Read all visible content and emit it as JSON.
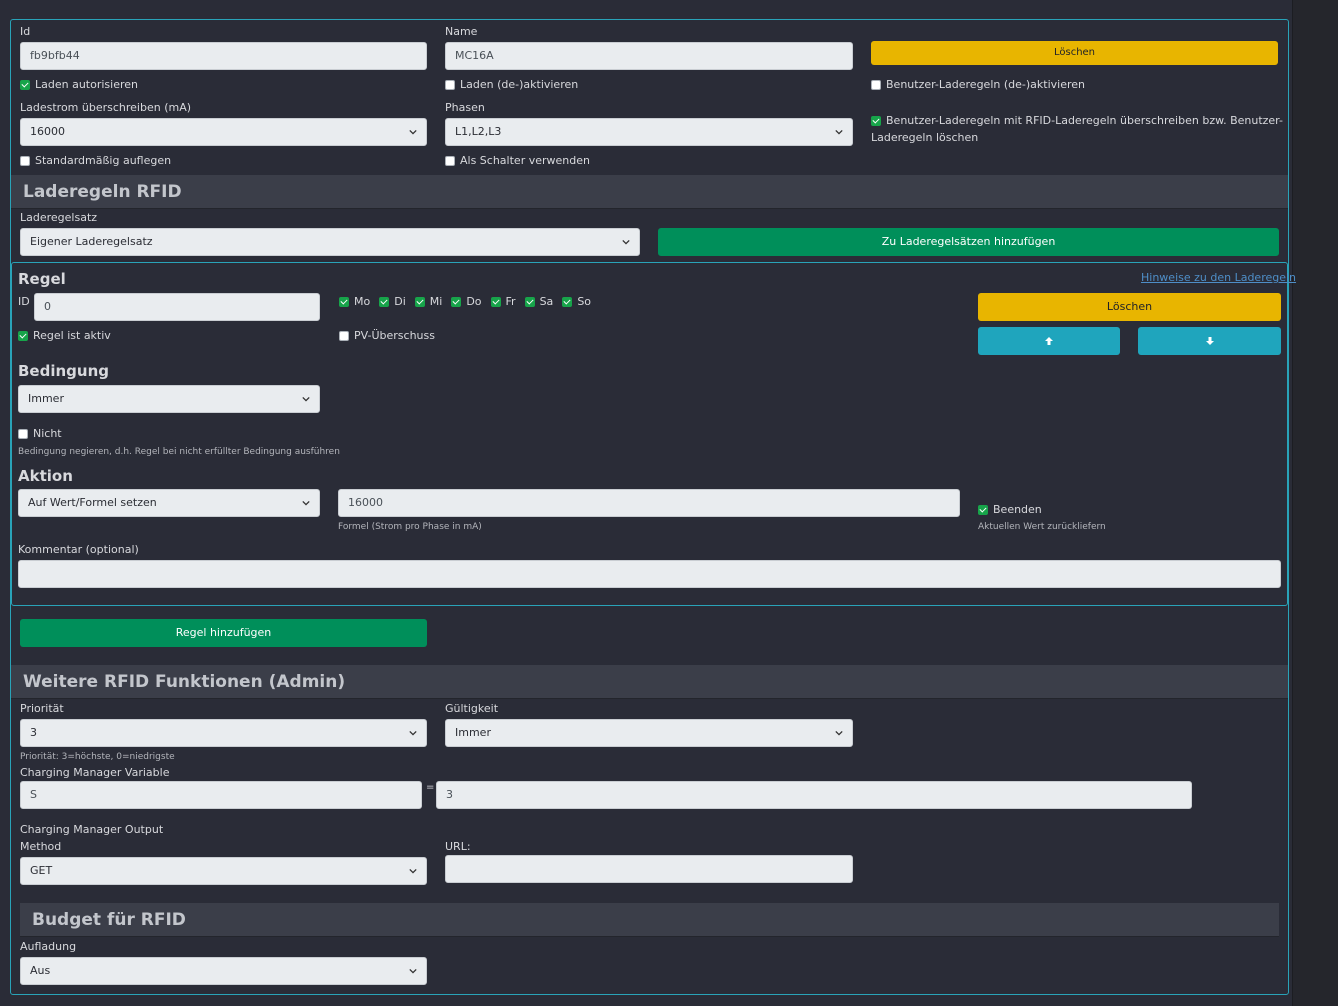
{
  "top": {
    "id_label": "Id",
    "id_value": "fb9bfb44",
    "name_label": "Name",
    "name_value": "MC16A",
    "delete_label": "Löschen",
    "laden_autorisieren": "Laden autorisieren",
    "laden_deaktivieren": "Laden (de-)aktivieren",
    "benutzer_deaktivieren": "Benutzer-Laderegeln (de-)aktivieren",
    "ladestrom_label": "Ladestrom überschreiben (mA)",
    "ladestrom_value": "16000",
    "phasen_label": "Phasen",
    "phasen_value": "L1,L2,L3",
    "benutzer_ueberschreiben_line1": "Benutzer-Laderegeln mit RFID-Laderegeln überschreiben bzw. Benutzer-",
    "benutzer_ueberschreiben_line2": "Laderegeln löschen",
    "standard_auflegen": "Standardmäßig auflegen",
    "als_schalter": "Als Schalter verwenden"
  },
  "laderegeln": {
    "section_title": "Laderegeln RFID",
    "satz_label": "Laderegelsatz",
    "satz_value": "Eigener Laderegelsatz",
    "add_to_sets_label": "Zu Laderegelsätzen hinzufügen"
  },
  "regel": {
    "title": "Regel",
    "hint_link": "Hinweise zu den Laderegeln",
    "id_label": "ID",
    "id_value": "0",
    "days": [
      "Mo",
      "Di",
      "Mi",
      "Do",
      "Fr",
      "Sa",
      "So"
    ],
    "delete_label": "Löschen",
    "aktiv_label": "Regel ist aktiv",
    "pv_label": "PV-Überschuss",
    "bedingung_title": "Bedingung",
    "bedingung_value": "Immer",
    "nicht_label": "Nicht",
    "nicht_help": "Bedingung negieren, d.h. Regel bei nicht erfüllter Bedingung ausführen",
    "aktion_title": "Aktion",
    "aktion_value": "Auf Wert/Formel setzen",
    "formel_value": "16000",
    "formel_help": "Formel (Strom pro Phase in mA)",
    "beenden_label": "Beenden",
    "beenden_help": "Aktuellen Wert zurückliefern",
    "kommentar_label": "Kommentar (optional)",
    "kommentar_value": ""
  },
  "add_rule_label": "Regel hinzufügen",
  "weitere": {
    "section_title": "Weitere RFID Funktionen (Admin)",
    "prioritaet_label": "Priorität",
    "prioritaet_value": "3",
    "prioritaet_help": "Priorität: 3=höchste, 0=niedrigste",
    "gueltigkeit_label": "Gültigkeit",
    "gueltigkeit_value": "Immer",
    "cm_variable_label": "Charging Manager Variable",
    "cm_variable_name": "S",
    "equals": "=",
    "cm_variable_value": "3",
    "cm_output_label": "Charging Manager Output",
    "method_label": "Method",
    "method_value": "GET",
    "url_label": "URL:",
    "url_value": ""
  },
  "budget": {
    "section_title": "Budget für RFID",
    "aufladung_label": "Aufladung",
    "aufladung_value": "Aus"
  },
  "colors": {
    "accent_border": "#29a3b8",
    "yellow": "#e8b500",
    "green": "#008f5a",
    "teal": "#1fa5bd"
  }
}
